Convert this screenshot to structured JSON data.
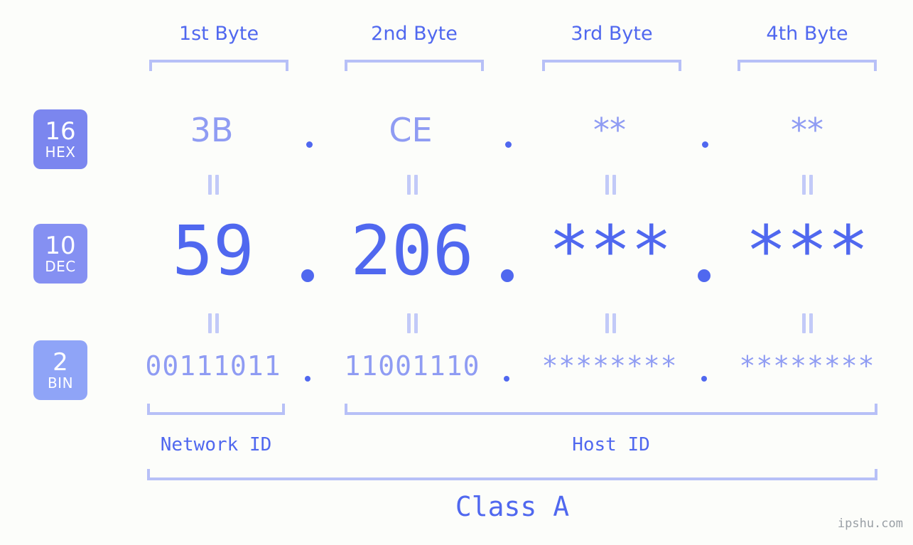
{
  "background_color": "#fcfdfa",
  "accent_color": "#5068ef",
  "accent_light_color": "#8f9cf3",
  "bracket_color": "#b7c0f7",
  "headers": [
    {
      "label": "1st Byte"
    },
    {
      "label": "2nd Byte"
    },
    {
      "label": "3rd Byte"
    },
    {
      "label": "4th Byte"
    }
  ],
  "bases": [
    {
      "number": "16",
      "name": "HEX",
      "color": "#7b86ef"
    },
    {
      "number": "10",
      "name": "DEC",
      "color": "#8590f2"
    },
    {
      "number": "2",
      "name": "BIN",
      "color": "#8fa4f7"
    }
  ],
  "rows": {
    "hex": {
      "values": [
        "3B",
        "CE",
        "**",
        "**"
      ]
    },
    "dec": {
      "values": [
        "59",
        "206",
        "***",
        "***"
      ]
    },
    "bin": {
      "values": [
        "00111011",
        "11001110",
        "********",
        "********"
      ]
    }
  },
  "separator": ".",
  "equals_sign": "=",
  "sections": {
    "network_id": "Network ID",
    "host_id": "Host ID",
    "class": "Class A"
  },
  "watermark": "ipshu.com"
}
